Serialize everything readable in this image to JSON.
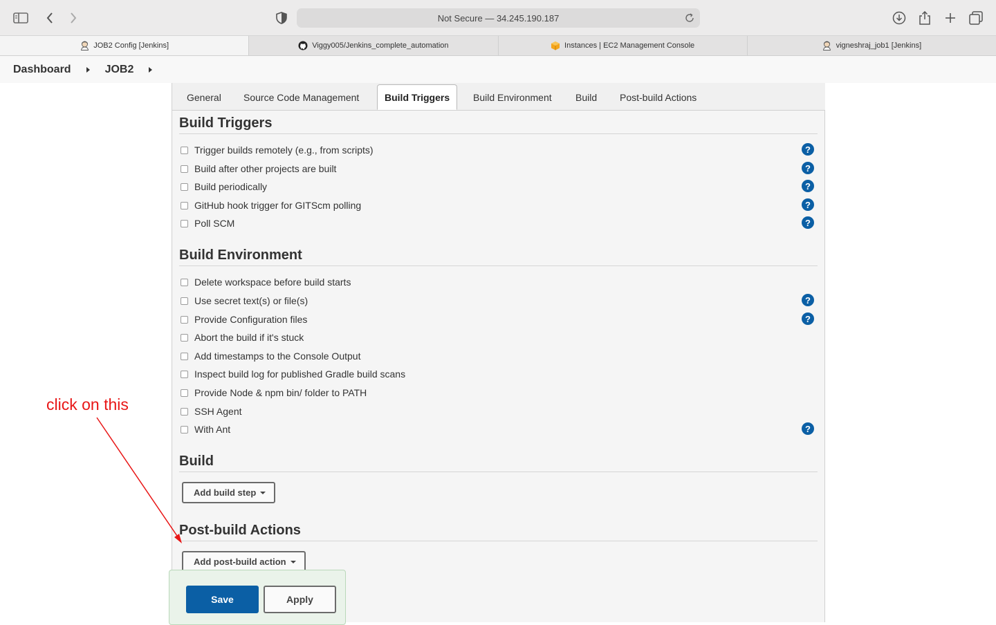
{
  "browser": {
    "url_text": "Not Secure — 34.245.190.187",
    "tabs": [
      {
        "label": "JOB2 Config [Jenkins]",
        "icon": "jenkins-icon"
      },
      {
        "label": "Viggy005/Jenkins_complete_automation",
        "icon": "github-icon"
      },
      {
        "label": "Instances | EC2 Management Console",
        "icon": "aws-icon"
      },
      {
        "label": "vigneshraj_job1 [Jenkins]",
        "icon": "jenkins-icon"
      }
    ]
  },
  "breadcrumb": {
    "items": [
      "Dashboard",
      "JOB2"
    ]
  },
  "config_tabs": [
    "General",
    "Source Code Management",
    "Build Triggers",
    "Build Environment",
    "Build",
    "Post-build Actions"
  ],
  "active_tab": "Build Triggers",
  "build_triggers": {
    "title": "Build Triggers",
    "options": [
      {
        "label": "Trigger builds remotely (e.g., from scripts)",
        "help": true
      },
      {
        "label": "Build after other projects are built",
        "help": true
      },
      {
        "label": "Build periodically",
        "help": true
      },
      {
        "label": "GitHub hook trigger for GITScm polling",
        "help": true
      },
      {
        "label": "Poll SCM",
        "help": true
      }
    ]
  },
  "build_environment": {
    "title": "Build Environment",
    "options": [
      {
        "label": "Delete workspace before build starts",
        "help": false
      },
      {
        "label": "Use secret text(s) or file(s)",
        "help": true
      },
      {
        "label": "Provide Configuration files",
        "help": true
      },
      {
        "label": "Abort the build if it's stuck",
        "help": false
      },
      {
        "label": "Add timestamps to the Console Output",
        "help": false
      },
      {
        "label": "Inspect build log for published Gradle build scans",
        "help": false
      },
      {
        "label": "Provide Node & npm bin/ folder to PATH",
        "help": false
      },
      {
        "label": "SSH Agent",
        "help": false
      },
      {
        "label": "With Ant",
        "help": true
      }
    ]
  },
  "build": {
    "title": "Build",
    "add_button": "Add build step"
  },
  "post_build": {
    "title": "Post-build Actions",
    "add_button": "Add post-build action"
  },
  "actions": {
    "save": "Save",
    "apply": "Apply"
  },
  "annotation": {
    "text": "click on this",
    "color": "#e81616"
  },
  "colors": {
    "primary": "#0b5fa5",
    "help_icon": "#0b5fa5"
  }
}
